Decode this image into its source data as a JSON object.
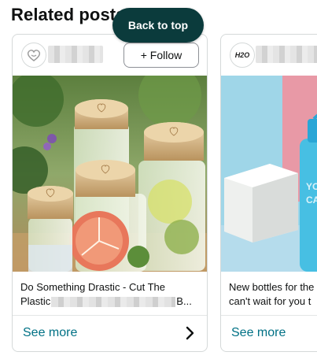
{
  "section": {
    "title": "Related posts"
  },
  "back_to_top": {
    "label": "Back to top"
  },
  "posts": [
    {
      "avatar_icon": "heart-logo-icon",
      "follow_label": "+ Follow",
      "caption_line1": "Do Something Drastic - Cut The",
      "caption_line2_start": "Plastic",
      "caption_line2_end": "B...",
      "see_more_label": "See more",
      "chevron_icon": "chevron-right-icon"
    },
    {
      "avatar_text": "H2O",
      "caption_line1": "New bottles for the",
      "caption_line2": "can't wait for you t",
      "see_more_label": "See more"
    }
  ],
  "colors": {
    "back_to_top_bg": "#0b3b3c",
    "link": "#007185",
    "border": "#d5d9d9"
  }
}
